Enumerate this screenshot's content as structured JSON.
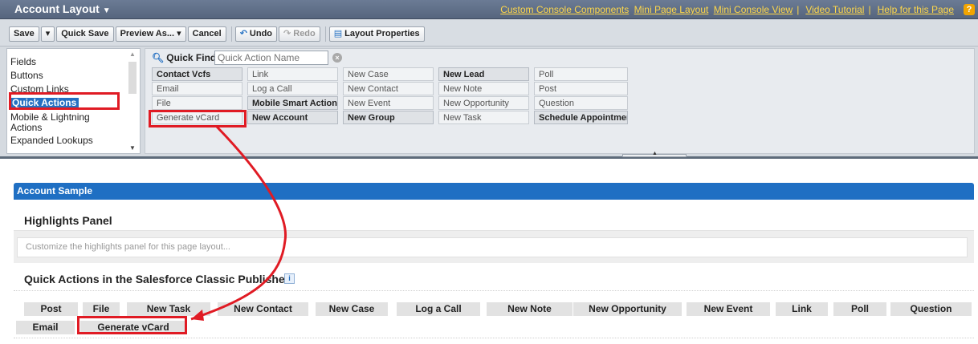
{
  "header": {
    "title": "Account Layout",
    "links": [
      "Custom Console Components",
      "Mini Page Layout",
      "Mini Console View",
      "Video Tutorial",
      "Help for this Page"
    ],
    "separator": "|",
    "help_glyph": "?"
  },
  "toolbar": {
    "save": "Save",
    "save_menu": "▾",
    "quick_save": "Quick Save",
    "preview_as": "Preview As...",
    "preview_caret": "▾",
    "cancel": "Cancel",
    "undo": "Undo",
    "redo": "Redo",
    "layout_properties": "Layout Properties"
  },
  "palette": {
    "categories": [
      "Fields",
      "Buttons",
      "Custom Links",
      "Quick Actions",
      "Mobile & Lightning Actions",
      "Expanded Lookups"
    ],
    "selected_category": "Quick Actions",
    "quick_find_label": "Quick Find",
    "quick_find_placeholder": "Quick Action Name",
    "clear_glyph": "×",
    "items": [
      {
        "label": "Contact Vcfs",
        "used": true
      },
      {
        "label": "Link",
        "used": false
      },
      {
        "label": "New Case",
        "used": false
      },
      {
        "label": "New Lead",
        "used": true
      },
      {
        "label": "Poll",
        "used": false
      },
      {
        "label": "Email",
        "used": false
      },
      {
        "label": "Log a Call",
        "used": false
      },
      {
        "label": "New Contact",
        "used": false
      },
      {
        "label": "New Note",
        "used": false
      },
      {
        "label": "Post",
        "used": false
      },
      {
        "label": "File",
        "used": false
      },
      {
        "label": "Mobile Smart Actions",
        "used": true
      },
      {
        "label": "New Event",
        "used": false
      },
      {
        "label": "New Opportunity",
        "used": false
      },
      {
        "label": "Question",
        "used": false
      },
      {
        "label": "Generate vCard",
        "used": false
      },
      {
        "label": "New Account",
        "used": true
      },
      {
        "label": "New Group",
        "used": true
      },
      {
        "label": "New Task",
        "used": false
      },
      {
        "label": "Schedule Appointment",
        "used": true
      }
    ]
  },
  "layout": {
    "section_title": "Account Sample",
    "highlights_title": "Highlights Panel",
    "highlights_placeholder": "Customize the highlights panel for this page layout...",
    "publisher_title": "Quick Actions in the Salesforce Classic Publisher",
    "info_glyph": "i",
    "publisher_actions": [
      "Post",
      "File",
      "New Task",
      "New Contact",
      "New Case",
      "Log a Call",
      "New Note",
      "New Opportunity",
      "New Event",
      "Link",
      "Poll",
      "Question",
      "Email",
      "Generate vCard"
    ]
  },
  "annotation": {
    "highlight_color": "#e01b24"
  },
  "colors": {
    "title_bar": "#5f6e88",
    "link_yellow": "#ffd84a",
    "section_blue": "#1f6fc3",
    "selected_blue": "#2470c2"
  }
}
